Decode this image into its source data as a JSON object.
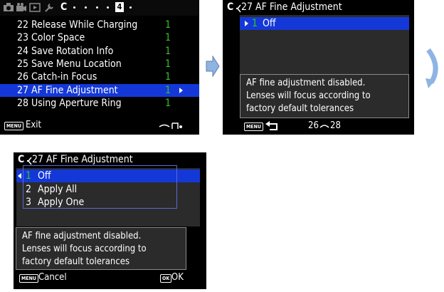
{
  "screen1": {
    "menu_tab": "C",
    "page_number": "4",
    "items": [
      {
        "num": "22",
        "label": "Release While Charging",
        "value": "1"
      },
      {
        "num": "23",
        "label": "Color Space",
        "value": "1"
      },
      {
        "num": "24",
        "label": "Save Rotation Info",
        "value": "1"
      },
      {
        "num": "25",
        "label": "Save Menu Location",
        "value": "1"
      },
      {
        "num": "26",
        "label": "Catch-in Focus",
        "value": "1"
      },
      {
        "num": "27",
        "label": "AF Fine Adjustment",
        "value": "1"
      },
      {
        "num": "28",
        "label": "Using Aperture Ring",
        "value": "1"
      }
    ],
    "selected_index": 5,
    "footer_badge": "MENU",
    "footer_label": "Exit"
  },
  "screen2": {
    "menu_tab": "C",
    "title": "27 AF Fine Adjustment",
    "selected_value": "1",
    "selected_label": "Off",
    "info_lines": [
      "AF fine adjustment disabled.",
      "Lenses will focus according to",
      "factory default tolerances"
    ],
    "footer_badge": "MENU",
    "footer_start": "26",
    "footer_end": "28"
  },
  "screen3": {
    "menu_tab": "C",
    "title": "27 AF Fine Adjustment",
    "options": [
      {
        "num": "1",
        "label": "Off"
      },
      {
        "num": "2",
        "label": "Apply All"
      },
      {
        "num": "3",
        "label": "Apply One"
      }
    ],
    "selected_index": 0,
    "info_lines": [
      "AF fine adjustment disabled.",
      "Lenses will focus according to",
      "factory default tolerances"
    ],
    "footer_badge_left": "MENU",
    "footer_label_left": "Cancel",
    "footer_badge_right": "OK",
    "footer_label_right": "OK"
  },
  "colors": {
    "highlight": "#1438d8",
    "value_green": "#35c628",
    "flow_arrow": "#8eb4e3"
  }
}
